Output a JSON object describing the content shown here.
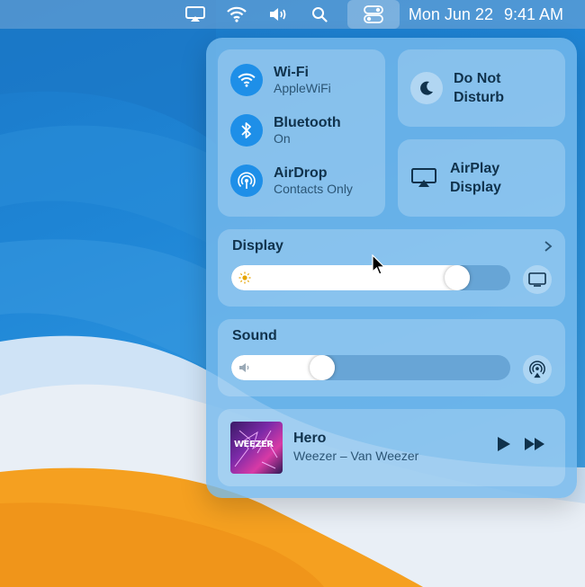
{
  "menubar": {
    "date": "Mon Jun 22",
    "time": "9:41 AM",
    "icons": [
      "airplay-icon",
      "wifi-icon",
      "volume-icon",
      "search-icon",
      "control-center-icon"
    ]
  },
  "control_center": {
    "wifi": {
      "title": "Wi-Fi",
      "subtitle": "AppleWiFi",
      "enabled": true
    },
    "bluetooth": {
      "title": "Bluetooth",
      "subtitle": "On",
      "enabled": true
    },
    "airdrop": {
      "title": "AirDrop",
      "subtitle": "Contacts Only",
      "enabled": true
    },
    "do_not_disturb": {
      "line1": "Do Not",
      "line2": "Disturb",
      "enabled": false
    },
    "airplay_display": {
      "line1": "AirPlay",
      "line2": "Display"
    },
    "display": {
      "title": "Display",
      "brightness": 0.84
    },
    "sound": {
      "title": "Sound",
      "volume": 0.31
    },
    "now_playing": {
      "title": "Hero",
      "subtitle": "Weezer – Van Weezer",
      "album_art_text": "WEEZER"
    }
  },
  "colors": {
    "accent": "#1e8fe8",
    "wallpaper_blue": "#1f86d6",
    "wallpaper_orange": "#f5a020",
    "panel": "#76baec"
  }
}
